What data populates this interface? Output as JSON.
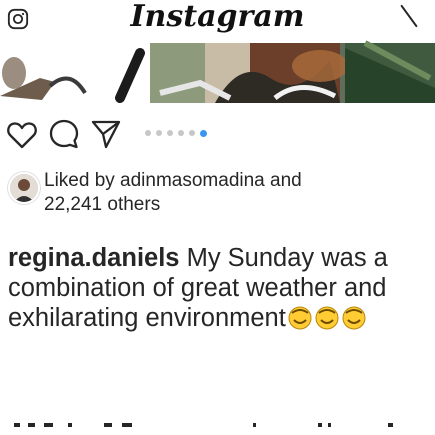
{
  "header": {
    "logo_text": "Instagram",
    "left_icon": "camera-icon",
    "right_icon": "send-icon"
  },
  "post": {
    "image": "post-photo",
    "carousel": {
      "count": 6,
      "active_index": 5
    }
  },
  "actions": {
    "icons": [
      "heart-icon",
      "comment-icon",
      "share-icon"
    ]
  },
  "likes": {
    "line1": "Liked by adinmasomadina and",
    "line2": "22,241 others"
  },
  "caption": {
    "username": "regina.daniels",
    "text": "My Sunday was a combination of great weather and exhilarating environment",
    "emoji_count": 3
  },
  "colors": {
    "accent": "#3897f0",
    "text": "#262626",
    "dot_inactive": "#c7c7c7"
  }
}
